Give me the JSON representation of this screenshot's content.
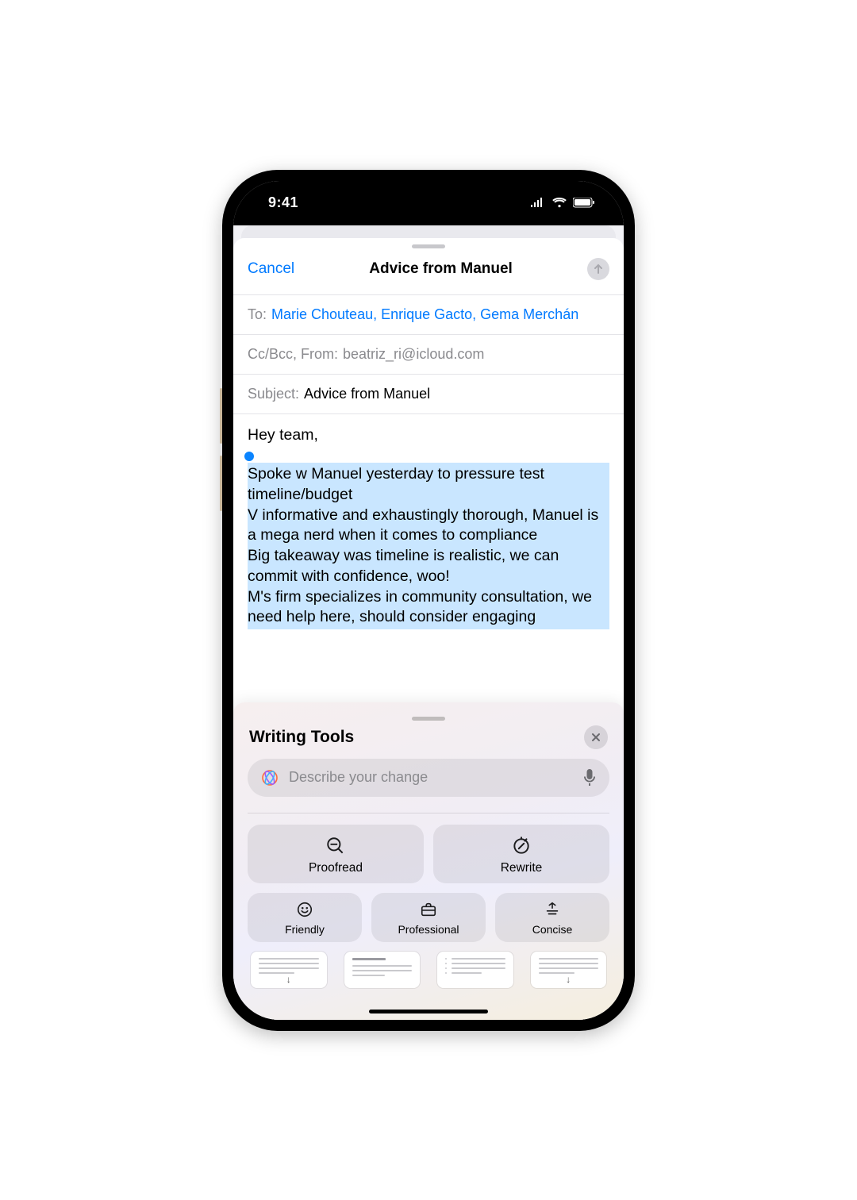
{
  "status": {
    "time": "9:41"
  },
  "compose": {
    "cancel": "Cancel",
    "title": "Advice from Manuel",
    "to_label": "To:",
    "recipients": "Marie Chouteau, Enrique Gacto, Gema Merchán",
    "cc_label": "Cc/Bcc, From:",
    "from_value": "beatriz_ri@icloud.com",
    "subject_label": "Subject:",
    "subject_value": "Advice from Manuel",
    "greeting": "Hey team,",
    "body": "Spoke w Manuel yesterday to pressure test timeline/budget\nV informative and exhaustingly thorough, Manuel is a mega nerd when it comes to compliance\nBig takeaway was timeline is realistic, we can commit with confidence, woo!\nM's firm specializes in community consultation, we need help here, should consider engaging"
  },
  "writing_tools": {
    "title": "Writing Tools",
    "placeholder": "Describe your change",
    "buttons": {
      "proofread": "Proofread",
      "rewrite": "Rewrite",
      "friendly": "Friendly",
      "professional": "Professional",
      "concise": "Concise"
    }
  }
}
